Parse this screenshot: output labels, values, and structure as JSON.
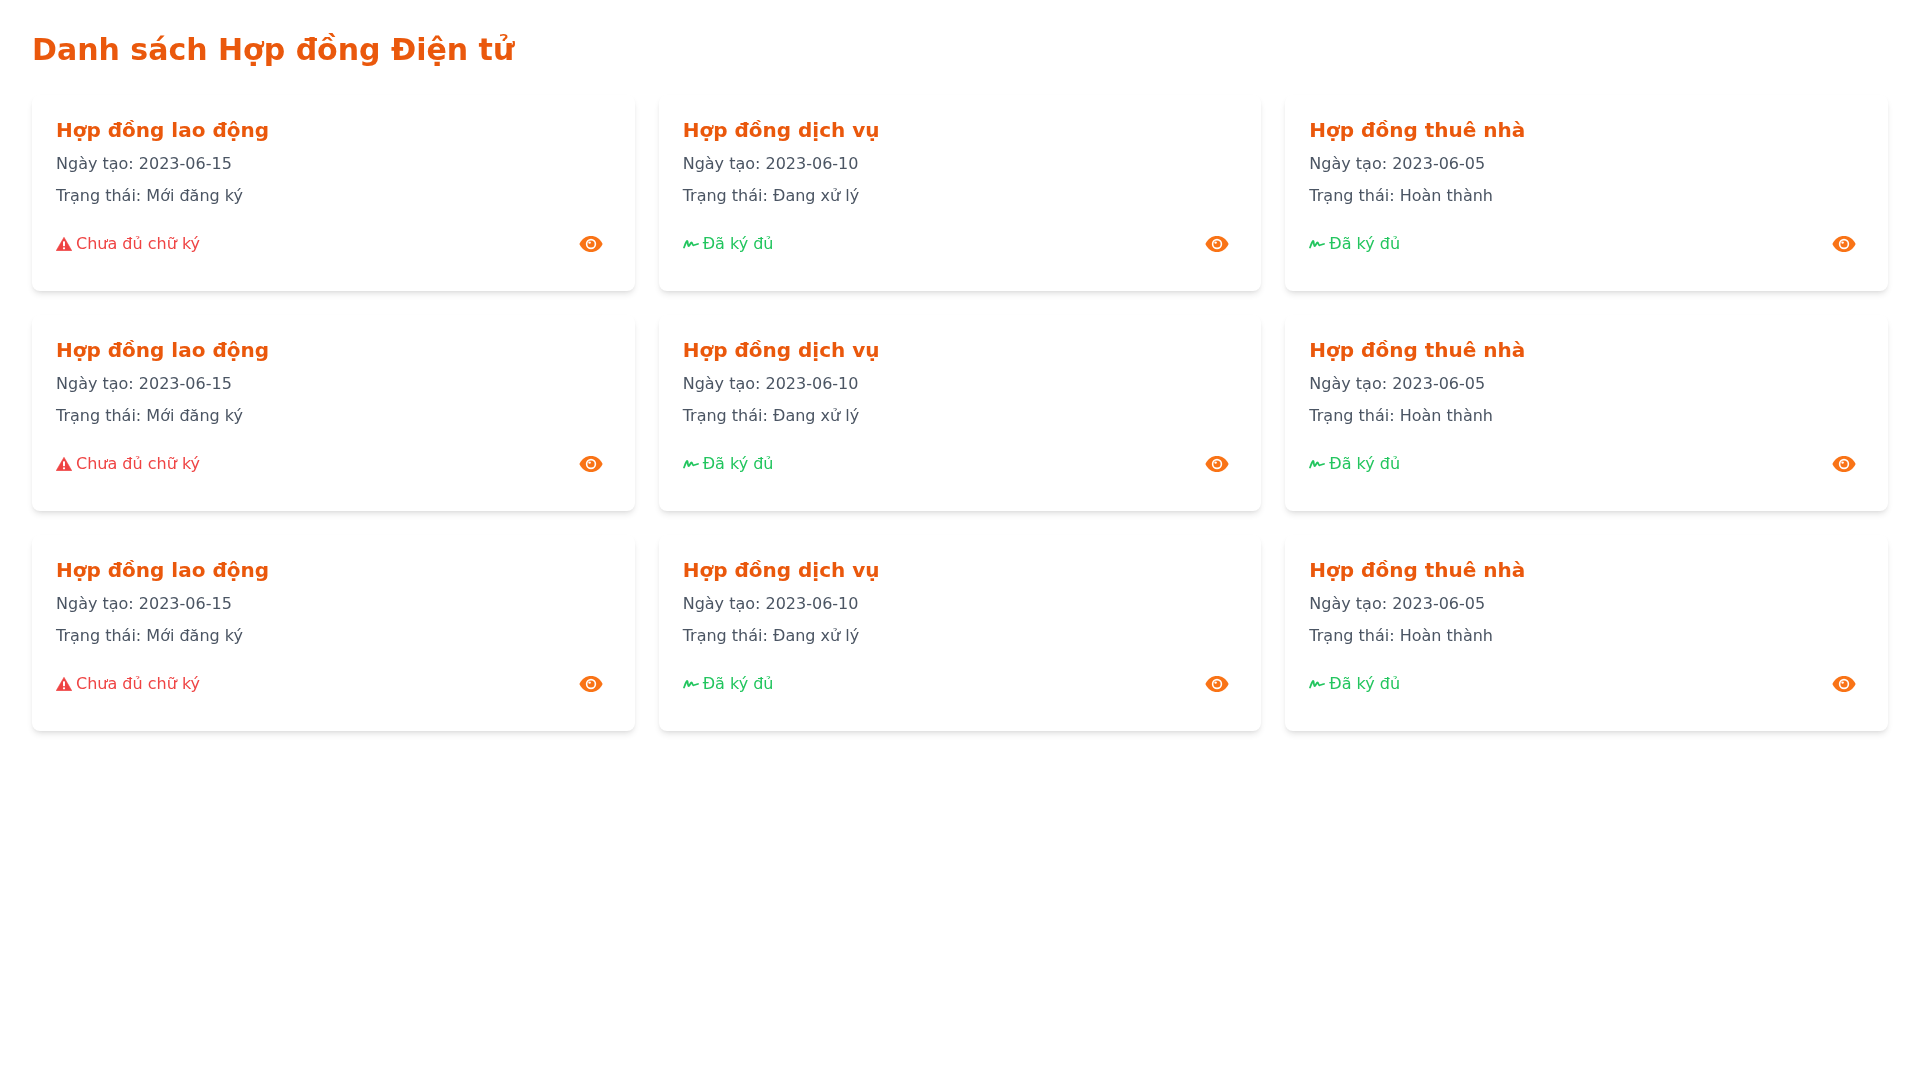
{
  "page": {
    "title": "Danh sách Hợp đồng Điện tử"
  },
  "contracts": [
    {
      "title": "Hợp đồng lao động",
      "created": "Ngày tạo: 2023-06-15",
      "status": "Trạng thái: Mới đăng ký",
      "signed": false,
      "signature_label": "Chưa đủ chữ ký"
    },
    {
      "title": "Hợp đồng dịch vụ",
      "created": "Ngày tạo: 2023-06-10",
      "status": "Trạng thái: Đang xử lý",
      "signed": true,
      "signature_label": "Đã ký đủ"
    },
    {
      "title": "Hợp đồng thuê nhà",
      "created": "Ngày tạo: 2023-06-05",
      "status": "Trạng thái: Hoàn thành",
      "signed": true,
      "signature_label": "Đã ký đủ"
    },
    {
      "title": "Hợp đồng lao động",
      "created": "Ngày tạo: 2023-06-15",
      "status": "Trạng thái: Mới đăng ký",
      "signed": false,
      "signature_label": "Chưa đủ chữ ký"
    },
    {
      "title": "Hợp đồng dịch vụ",
      "created": "Ngày tạo: 2023-06-10",
      "status": "Trạng thái: Đang xử lý",
      "signed": true,
      "signature_label": "Đã ký đủ"
    },
    {
      "title": "Hợp đồng thuê nhà",
      "created": "Ngày tạo: 2023-06-05",
      "status": "Trạng thái: Hoàn thành",
      "signed": true,
      "signature_label": "Đã ký đủ"
    },
    {
      "title": "Hợp đồng lao động",
      "created": "Ngày tạo: 2023-06-15",
      "status": "Trạng thái: Mới đăng ký",
      "signed": false,
      "signature_label": "Chưa đủ chữ ký"
    },
    {
      "title": "Hợp đồng dịch vụ",
      "created": "Ngày tạo: 2023-06-10",
      "status": "Trạng thái: Đang xử lý",
      "signed": true,
      "signature_label": "Đã ký đủ"
    },
    {
      "title": "Hợp đồng thuê nhà",
      "created": "Ngày tạo: 2023-06-05",
      "status": "Trạng thái: Hoàn thành",
      "signed": true,
      "signature_label": "Đã ký đủ"
    }
  ]
}
